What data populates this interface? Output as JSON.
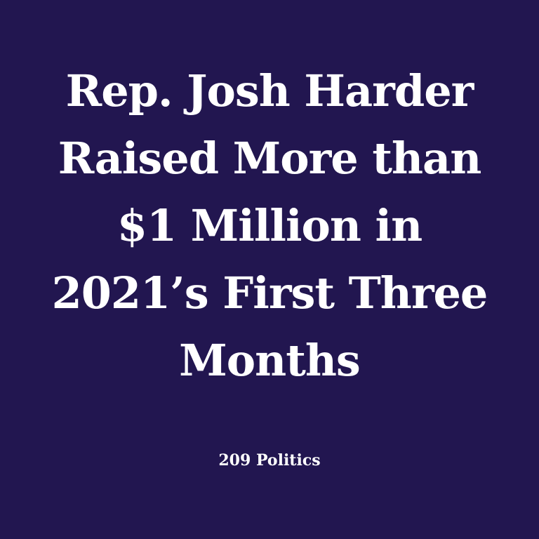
{
  "background_color": "#221650",
  "text_color": "#ffffff",
  "headline": {
    "lines": [
      "Rep. Josh Harder",
      "Raised More than",
      "$1 Million in",
      "2021’s First Three",
      "Months"
    ]
  },
  "source": {
    "label": "209 Politics"
  }
}
